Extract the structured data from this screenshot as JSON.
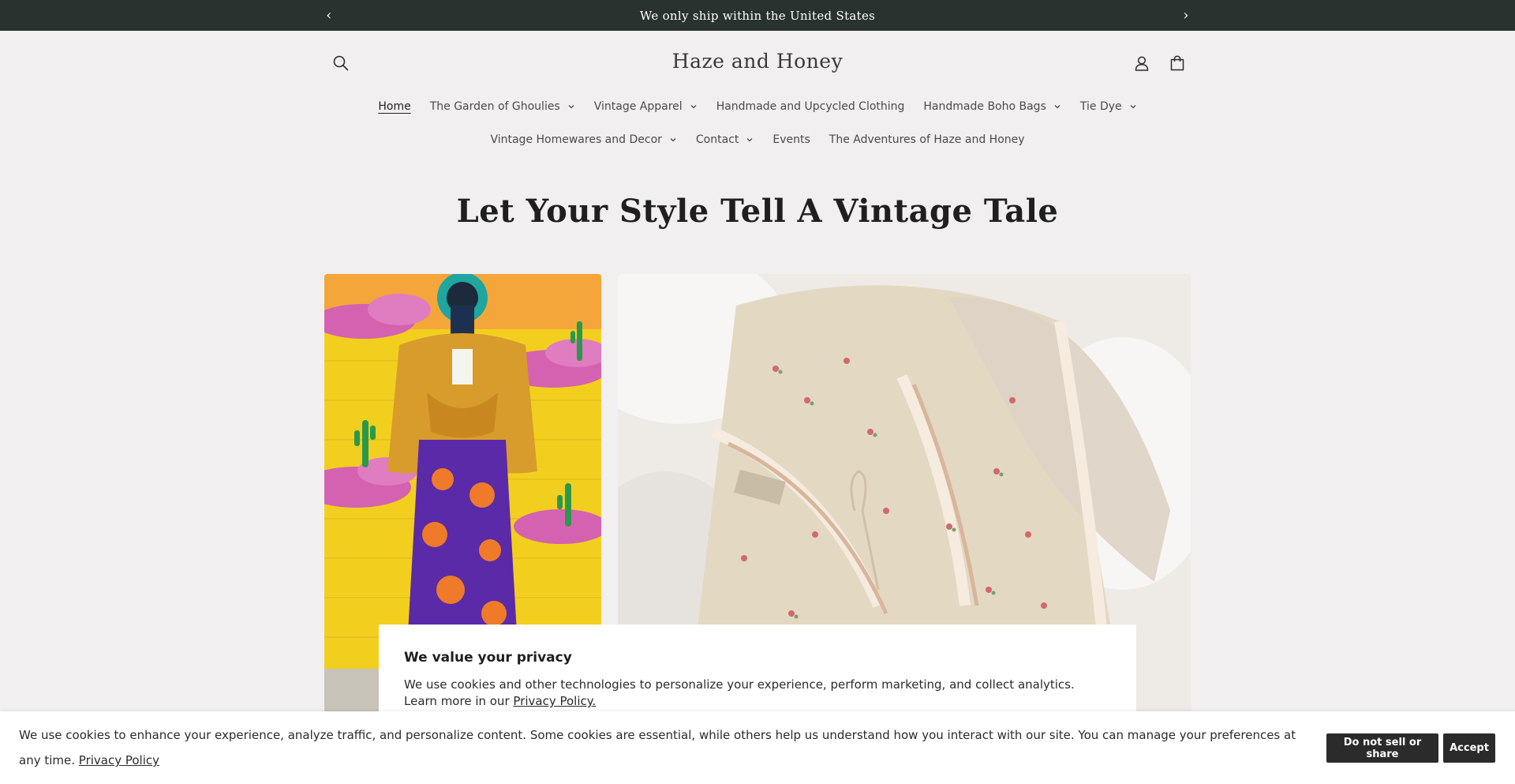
{
  "announcement": {
    "text": "We only ship within the United States",
    "prev_glyph": "‹",
    "next_glyph": "›"
  },
  "header": {
    "logo": "Haze and Honey",
    "icons": [
      "search-icon",
      "account-icon",
      "cart-icon"
    ]
  },
  "nav": {
    "row1": [
      {
        "label": "Home",
        "active": true,
        "dropdown": false
      },
      {
        "label": "The Garden of Ghoulies",
        "dropdown": true
      },
      {
        "label": "Vintage Apparel",
        "dropdown": true
      },
      {
        "label": "Handmade and Upcycled Clothing",
        "dropdown": false
      },
      {
        "label": "Handmade Boho Bags",
        "dropdown": true
      },
      {
        "label": "Tie Dye",
        "dropdown": true
      }
    ],
    "row2": [
      {
        "label": "Vintage Homewares and Decor",
        "dropdown": true
      },
      {
        "label": "Contact",
        "dropdown": true
      },
      {
        "label": "Events",
        "dropdown": false
      },
      {
        "label": "The Adventures of Haze and Honey",
        "dropdown": false
      }
    ]
  },
  "hero": {
    "title": "Let Your Style Tell A Vintage Tale"
  },
  "privacy_modal": {
    "title": "We value your privacy",
    "text": "We use cookies and other technologies to personalize your experience, perform marketing, and collect analytics. Learn more in our ",
    "link": "Privacy Policy."
  },
  "cookie_bar": {
    "text": "We use cookies to enhance your experience, analyze traffic, and personalize content. Some cookies are essential, while others help us understand how you interact with our site. You can manage your preferences at any time. ",
    "link": "Privacy Policy",
    "do_not_sell_label": "Do not sell or share",
    "accept_label": "Accept"
  },
  "colors": {
    "announcement_bg": "#2a322f",
    "page_bg": "#f1eff0",
    "button_bg": "#2b2b2b"
  }
}
